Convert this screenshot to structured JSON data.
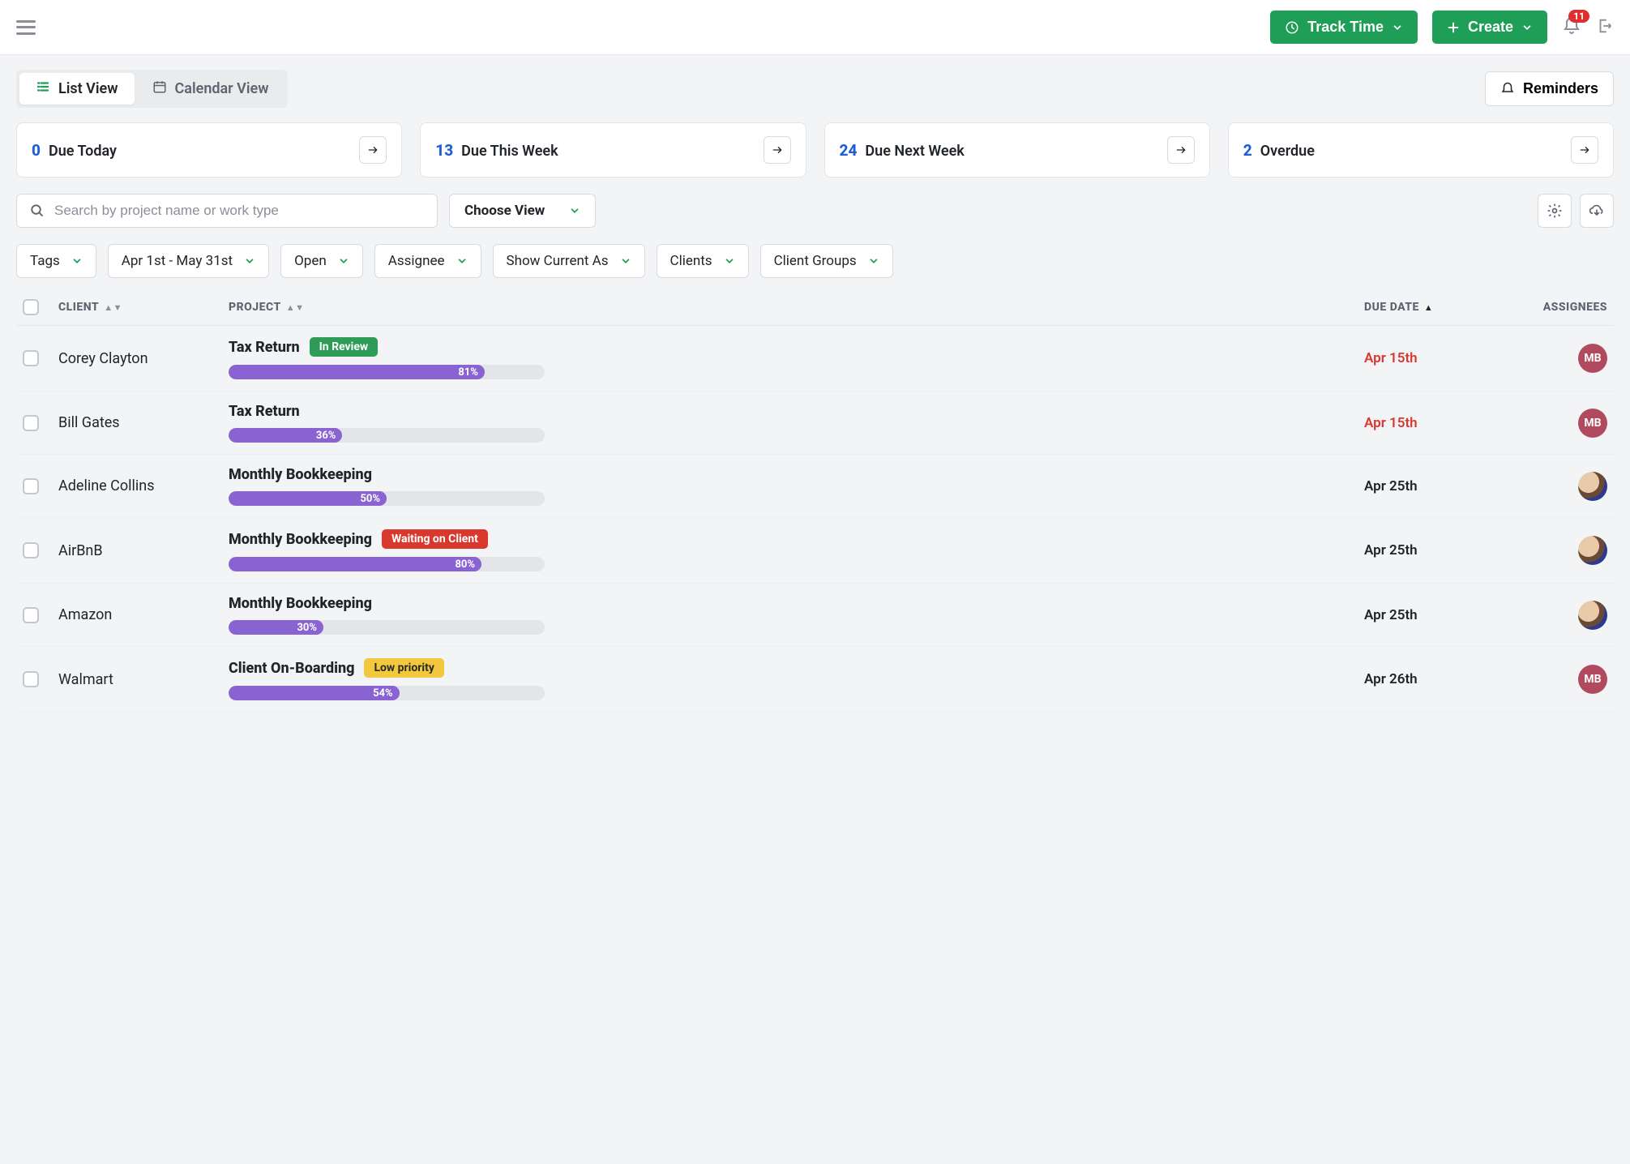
{
  "header": {
    "track_time_label": "Track Time",
    "create_label": "Create",
    "notification_count": "11"
  },
  "view_tabs": {
    "list_label": "List View",
    "calendar_label": "Calendar View",
    "reminders_label": "Reminders"
  },
  "summary": [
    {
      "count": "0",
      "label": "Due Today"
    },
    {
      "count": "13",
      "label": "Due This Week"
    },
    {
      "count": "24",
      "label": "Due Next Week"
    },
    {
      "count": "2",
      "label": "Overdue"
    }
  ],
  "search": {
    "placeholder": "Search by project name or work type"
  },
  "choose_view_label": "Choose View",
  "filters": [
    "Tags",
    "Apr 1st - May 31st",
    "Open",
    "Assignee",
    "Show Current As",
    "Clients",
    "Client Groups"
  ],
  "columns": {
    "client": "CLIENT",
    "project": "PROJECT",
    "due_date": "DUE DATE",
    "assignees": "ASSIGNEES"
  },
  "rows": [
    {
      "client": "Corey Clayton",
      "project": "Tax Return",
      "status": "In Review",
      "status_style": "pill-green",
      "progress": 81,
      "progress_label": "81%",
      "due": "Apr 15th",
      "due_style": "due-red",
      "assignee": "MB",
      "avatar_style": "avatar-mb"
    },
    {
      "client": "Bill Gates",
      "project": "Tax Return",
      "status": null,
      "status_style": "",
      "progress": 36,
      "progress_label": "36%",
      "due": "Apr 15th",
      "due_style": "due-red",
      "assignee": "MB",
      "avatar_style": "avatar-mb"
    },
    {
      "client": "Adeline Collins",
      "project": "Monthly Bookkeeping",
      "status": null,
      "status_style": "",
      "progress": 50,
      "progress_label": "50%",
      "due": "Apr 25th",
      "due_style": "due-normal",
      "assignee": "photo",
      "avatar_style": "avatar-photo"
    },
    {
      "client": "AirBnB",
      "project": "Monthly Bookkeeping",
      "status": "Waiting on Client",
      "status_style": "pill-red",
      "progress": 80,
      "progress_label": "80%",
      "due": "Apr 25th",
      "due_style": "due-normal",
      "assignee": "photo",
      "avatar_style": "avatar-photo"
    },
    {
      "client": "Amazon",
      "project": "Monthly Bookkeeping",
      "status": null,
      "status_style": "",
      "progress": 30,
      "progress_label": "30%",
      "due": "Apr 25th",
      "due_style": "due-normal",
      "assignee": "photo",
      "avatar_style": "avatar-photo"
    },
    {
      "client": "Walmart",
      "project": "Client On-Boarding",
      "status": "Low priority",
      "status_style": "pill-yellow",
      "progress": 54,
      "progress_label": "54%",
      "due": "Apr 26th",
      "due_style": "due-normal",
      "assignee": "MB",
      "avatar_style": "avatar-mb"
    }
  ]
}
